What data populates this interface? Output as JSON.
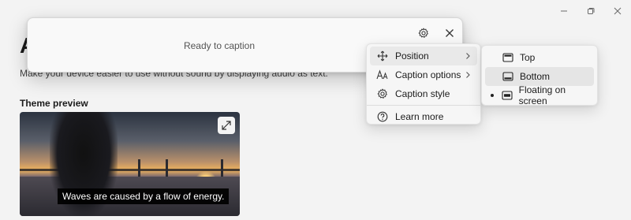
{
  "window": {
    "controls": {
      "minimize": "minimize-icon",
      "maximize": "restore-icon",
      "close": "close-icon"
    }
  },
  "settings_page": {
    "heading": "A",
    "description": "Make your device easier to use without sound by displaying audio as text.",
    "theme_preview_title": "Theme preview",
    "preview_caption": "Waves are caused by a flow of energy."
  },
  "live_captions": {
    "status": "Ready to caption",
    "settings_icon": "gear-icon",
    "close_icon": "close-icon"
  },
  "settings_menu": {
    "items": [
      {
        "label": "Position",
        "icon": "move-icon",
        "has_submenu": true,
        "highlighted": true
      },
      {
        "label": "Caption options",
        "icon": "caption-options-icon",
        "has_submenu": true,
        "highlighted": false
      },
      {
        "label": "Caption style",
        "icon": "gear-icon",
        "has_submenu": false,
        "highlighted": false
      },
      {
        "label": "Learn more",
        "icon": "help-icon",
        "has_submenu": false,
        "highlighted": false
      }
    ]
  },
  "position_submenu": {
    "items": [
      {
        "label": "Top",
        "icon": "position-top-icon",
        "checked": false,
        "highlighted": false
      },
      {
        "label": "Bottom",
        "icon": "position-bottom-icon",
        "checked": false,
        "highlighted": true
      },
      {
        "label": "Floating on screen",
        "icon": "position-floating-icon",
        "checked": true,
        "highlighted": false
      }
    ]
  },
  "colors": {
    "page_background": "#f3f3f3",
    "menu_background": "#f6f6f6",
    "menu_highlight": "#e9e9e9",
    "caption_background": "#000000"
  }
}
